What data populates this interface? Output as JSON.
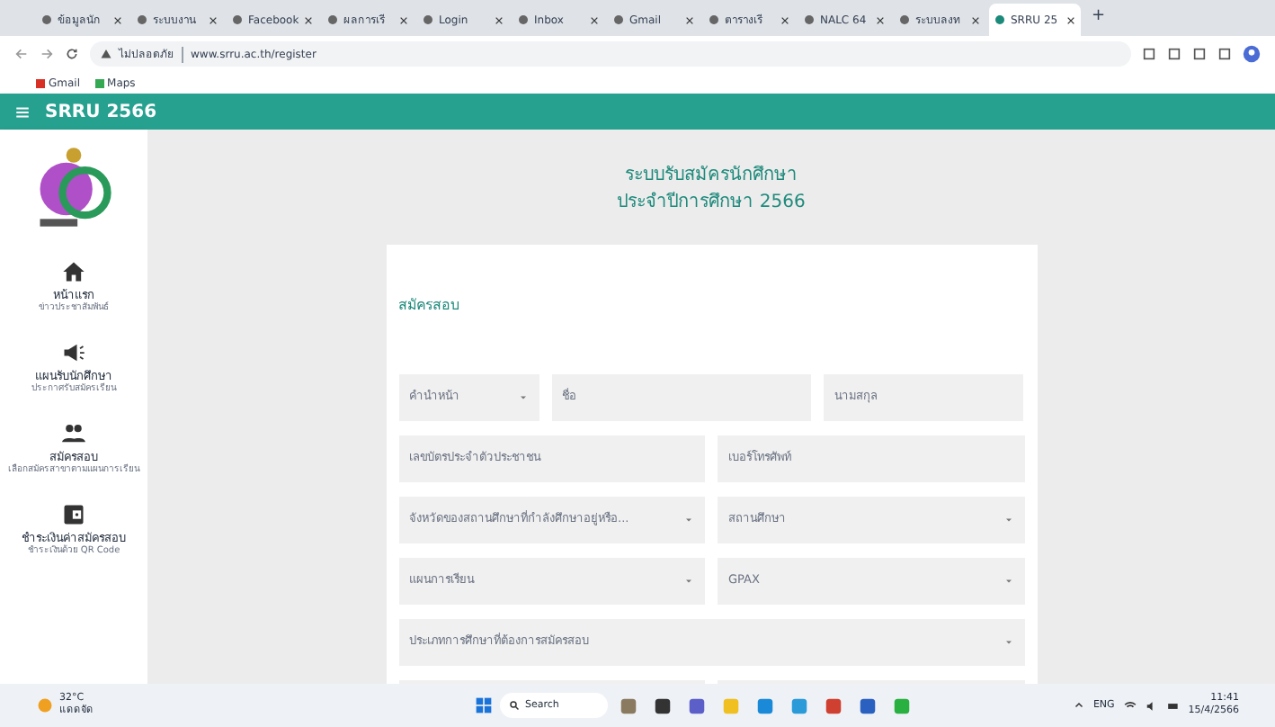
{
  "browser": {
    "tabs": [
      {
        "title": "ข้อมูลนัก",
        "selected": false
      },
      {
        "title": "ระบบงาน",
        "selected": false
      },
      {
        "title": "Facebook",
        "selected": false
      },
      {
        "title": "ผลการเรี",
        "selected": false
      },
      {
        "title": "Login",
        "selected": false
      },
      {
        "title": "Inbox",
        "selected": false
      },
      {
        "title": "Gmail",
        "selected": false
      },
      {
        "title": "ตารางเรี",
        "selected": false
      },
      {
        "title": "NALC 64",
        "selected": false
      },
      {
        "title": "ระบบลงท",
        "selected": false
      },
      {
        "title": "SRRU 25",
        "selected": true
      }
    ],
    "new_tab": "+",
    "security": "ไม่ปลอดภัย",
    "url": "www.srru.ac.th/register",
    "bookmarks": [
      "Gmail",
      "Maps"
    ]
  },
  "app_bar": {
    "title": "SRRU 2566"
  },
  "sidebar": {
    "items": [
      {
        "kind": "home",
        "label": "หน้าแรก",
        "sub": "ข่าวประชาสัมพันธ์"
      },
      {
        "kind": "announce",
        "label": "แผนรับนักศึกษา",
        "sub": "ประกาศรับสมัครเรียน"
      },
      {
        "kind": "people",
        "label": "สมัครสอบ",
        "sub": "เลือกสมัครสาขาตามแผนการเรียน"
      },
      {
        "kind": "wallet",
        "label": "ชำระเงินค่าสมัครสอบ",
        "sub": "ชำระเงินด้วย QR Code"
      }
    ]
  },
  "heading": [
    "ระบบรับสมัครนักศึกษา",
    "ประจำปีการศึกษา 2566"
  ],
  "form": {
    "title": "สมัครสอบ",
    "rows": [
      [
        {
          "kind": "select",
          "placeholder": "คำนำหน้า"
        },
        {
          "kind": "text",
          "placeholder": "ชื่อ"
        },
        {
          "kind": "text",
          "placeholder": "นามสกุล"
        }
      ],
      [
        {
          "kind": "text",
          "placeholder": "เลขบัตรประจำตัวประชาชน"
        },
        {
          "kind": "text",
          "placeholder": "เบอร์โทรศัพท์"
        }
      ],
      [
        {
          "kind": "select",
          "placeholder": "จังหวัดของสถานศึกษาที่กำลังศึกษาอยู่หรือ..."
        },
        {
          "kind": "select",
          "placeholder": "สถานศึกษา"
        }
      ],
      [
        {
          "kind": "select",
          "placeholder": "แผนการเรียน"
        },
        {
          "kind": "select",
          "placeholder": "GPAX"
        }
      ],
      [
        {
          "kind": "select",
          "placeholder": "ประเภทการศึกษาที่ต้องการสมัครสอบ"
        }
      ]
    ]
  },
  "taskbar": {
    "weather": "32°C",
    "weather_sub": "แดดจัด",
    "search": "Search",
    "lang": "ENG",
    "time": "11:41",
    "date": "15/4/2566"
  }
}
